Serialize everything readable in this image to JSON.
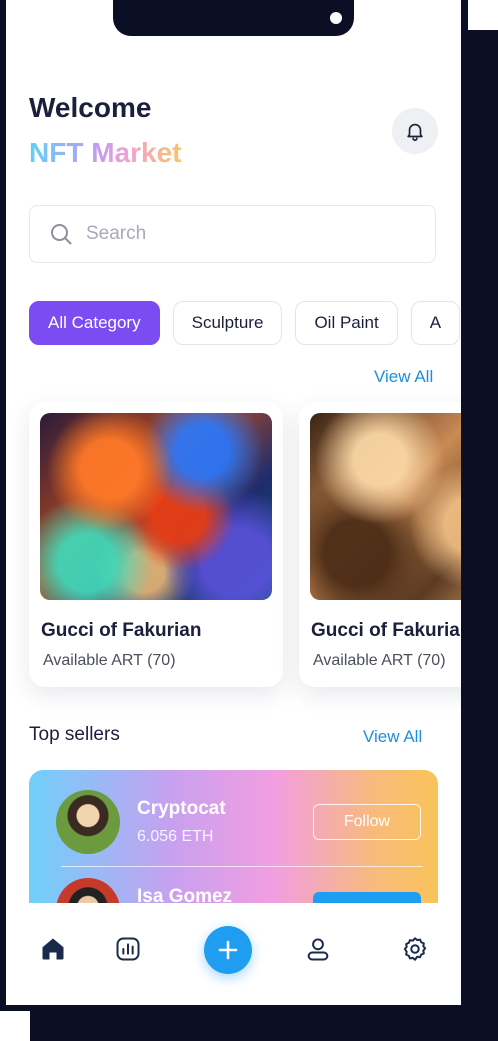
{
  "header": {
    "welcome": "Welcome",
    "brand": "NFT Market"
  },
  "search": {
    "placeholder": "Search",
    "value": ""
  },
  "categories": [
    {
      "label": "All Category",
      "active": true
    },
    {
      "label": "Sculpture",
      "active": false
    },
    {
      "label": "Oil Paint",
      "active": false
    },
    {
      "label": "A",
      "active": false
    }
  ],
  "featured": {
    "view_all": "View All",
    "cards": [
      {
        "title": "Gucci of Fakurian",
        "subtitle": "Available ART (70)"
      },
      {
        "title": "Gucci of Fakurian",
        "subtitle": "Available ART (70)"
      }
    ]
  },
  "top_sellers": {
    "title": "Top sellers",
    "view_all": "View All",
    "items": [
      {
        "name": "Cryptocat",
        "eth": "6.056 ETH",
        "button": "Follow"
      },
      {
        "name": "Isa Gomez",
        "eth": "",
        "button": ""
      }
    ]
  },
  "colors": {
    "accent_purple": "#7b4cf2",
    "accent_blue": "#1f9df0",
    "text_dark": "#1b1f3b",
    "frame_dark": "#0b0f26"
  },
  "icons": {
    "bell": "bell-icon",
    "search": "search-icon",
    "home": "home-icon",
    "stats": "chart-icon",
    "add": "plus-icon",
    "profile": "user-icon",
    "settings": "gear-icon"
  }
}
